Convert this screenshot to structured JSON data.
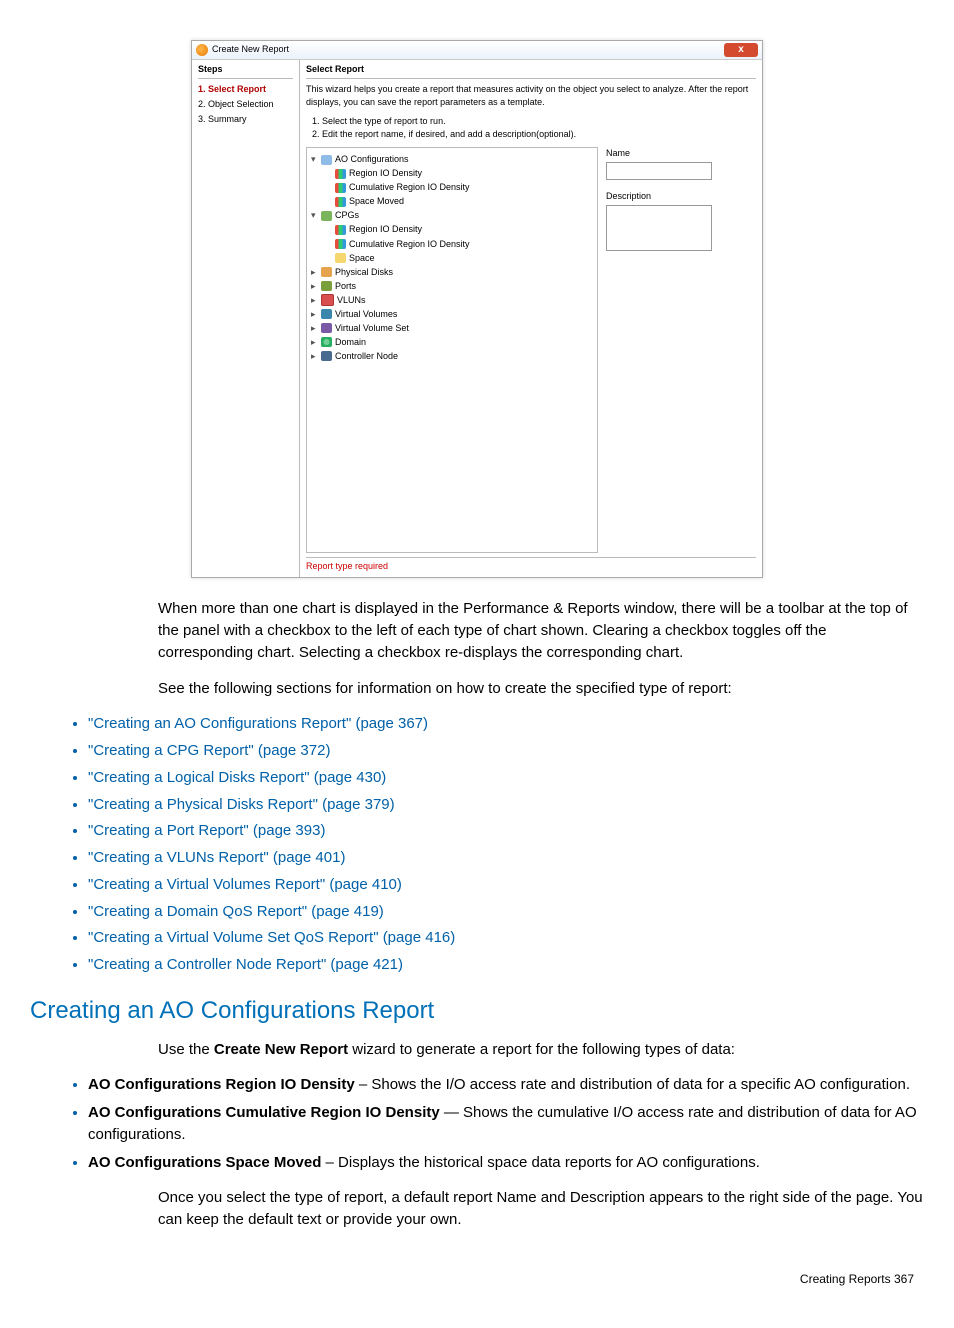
{
  "dialog": {
    "title": "Create New Report",
    "close": "x",
    "stepsHeader": "Steps",
    "steps": [
      {
        "label": "1. Select Report",
        "active": true
      },
      {
        "label": "2. Object Selection",
        "active": false
      },
      {
        "label": "3. Summary",
        "active": false
      }
    ],
    "mainHeader": "Select Report",
    "intro": "This wizard helps you create a report that measures activity on the object you select to analyze. After the report displays, you can save the report parameters as a template.",
    "instructions": [
      "Select the type of report to run.",
      "Edit the report name, if desired, and add a description(optional)."
    ],
    "tree": [
      {
        "toggle": "▾",
        "icon": "ico-folder",
        "label": "AO Configurations",
        "indent": 0
      },
      {
        "toggle": "",
        "icon": "ico-chart",
        "label": "Region IO Density",
        "indent": 1
      },
      {
        "toggle": "",
        "icon": "ico-chart",
        "label": "Cumulative Region IO Density",
        "indent": 1
      },
      {
        "toggle": "",
        "icon": "ico-chart",
        "label": "Space Moved",
        "indent": 1
      },
      {
        "toggle": "▾",
        "icon": "ico-cpg",
        "label": "CPGs",
        "indent": 0
      },
      {
        "toggle": "",
        "icon": "ico-chart",
        "label": "Region IO Density",
        "indent": 1
      },
      {
        "toggle": "",
        "icon": "ico-chart",
        "label": "Cumulative Region IO Density",
        "indent": 1
      },
      {
        "toggle": "",
        "icon": "ico-space",
        "label": "Space",
        "indent": 1
      },
      {
        "toggle": "▸",
        "icon": "ico-pd",
        "label": "Physical Disks",
        "indent": 0
      },
      {
        "toggle": "▸",
        "icon": "ico-ports",
        "label": "Ports",
        "indent": 0
      },
      {
        "toggle": "▸",
        "icon": "ico-vlun",
        "label": "VLUNs",
        "indent": 0
      },
      {
        "toggle": "▸",
        "icon": "ico-vv",
        "label": "Virtual Volumes",
        "indent": 0
      },
      {
        "toggle": "▸",
        "icon": "ico-vvs",
        "label": "Virtual Volume Set",
        "indent": 0
      },
      {
        "toggle": "▸",
        "icon": "ico-dom",
        "label": "Domain",
        "indent": 0
      },
      {
        "toggle": "▸",
        "icon": "ico-cn",
        "label": "Controller Node",
        "indent": 0
      }
    ],
    "nameLabel": "Name",
    "descLabel": "Description",
    "error": "Report type required"
  },
  "para1": "When more than one chart is displayed in the Performance & Reports window, there will be a toolbar at the top of the panel with a checkbox to the left of each type of chart shown. Clearing a checkbox toggles off the corresponding chart. Selecting a checkbox re-displays the corresponding chart.",
  "para2": "See the following sections for information on how to create the specified type of report:",
  "links": [
    "\"Creating an AO Configurations Report\" (page 367)",
    "\"Creating a CPG Report\" (page 372)",
    "\"Creating a Logical Disks Report\" (page 430)",
    "\"Creating a Physical Disks Report\" (page 379)",
    "\"Creating a Port Report\" (page 393)",
    "\"Creating a VLUNs Report\" (page 401)",
    "\"Creating a Virtual Volumes Report\" (page 410)",
    "\"Creating a Domain QoS Report\" (page 419)",
    "\"Creating a Virtual Volume Set QoS Report\" (page 416)",
    "\"Creating a Controller Node Report\" (page 421)"
  ],
  "sectionHeading": "Creating an AO Configurations Report",
  "para3a": "Use the ",
  "para3b": "Create New Report",
  "para3c": " wizard to generate a report for the following types of data:",
  "bullets": [
    {
      "bold": "AO Configurations Region IO Density",
      "rest": " – Shows the I/O access rate and distribution of data for a specific AO configuration."
    },
    {
      "bold": "AO Configurations Cumulative Region IO Density",
      "rest": " — Shows the cumulative I/O access rate and distribution of data for AO configurations."
    },
    {
      "bold": "AO Configurations Space Moved",
      "rest": " – Displays the historical space data reports for AO configurations."
    }
  ],
  "para4": "Once you select the type of report, a default report Name and Description appears to the right side of the page. You can keep the default text or provide your own.",
  "footer": "Creating Reports   367"
}
